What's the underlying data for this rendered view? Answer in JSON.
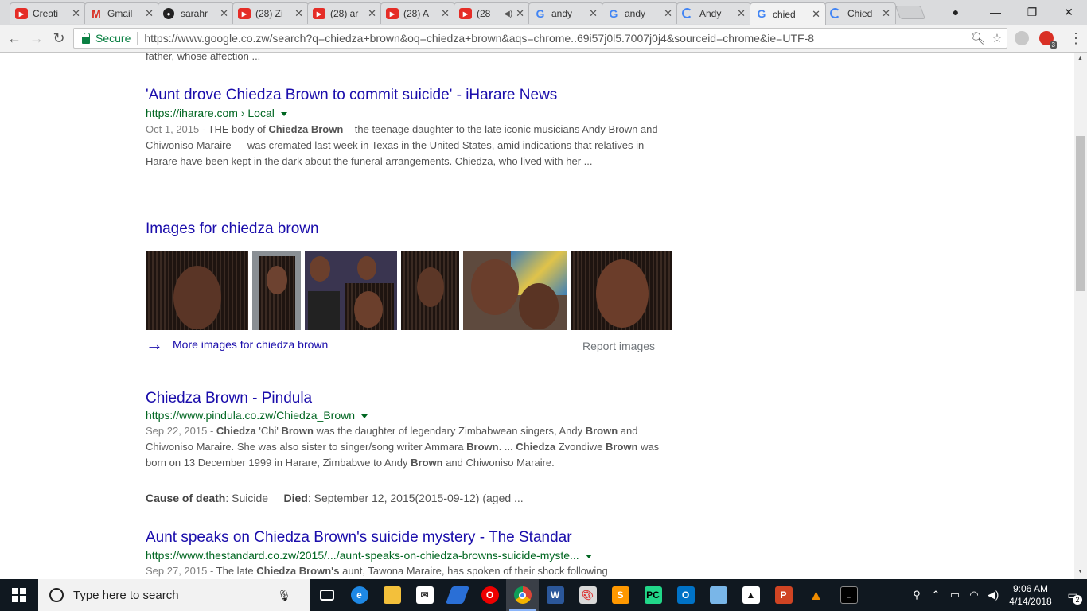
{
  "tabs": [
    {
      "title": "Creati",
      "favicon": "youtube-icon"
    },
    {
      "title": "Gmail",
      "favicon": "gmail-icon"
    },
    {
      "title": "sarahr",
      "favicon": "github-icon"
    },
    {
      "title": "(28) Zi",
      "favicon": "youtube-icon"
    },
    {
      "title": "(28) ar",
      "favicon": "youtube-icon"
    },
    {
      "title": "(28) A",
      "favicon": "youtube-icon"
    },
    {
      "title": "(28",
      "favicon": "youtube-icon",
      "audio": true
    },
    {
      "title": "andy",
      "favicon": "google-icon"
    },
    {
      "title": "andy",
      "favicon": "google-icon"
    },
    {
      "title": "Andy",
      "favicon": "loading-icon"
    },
    {
      "title": "chied",
      "favicon": "google-icon",
      "active": true
    },
    {
      "title": "Chied",
      "favicon": "loading-icon"
    }
  ],
  "toolbar": {
    "secure_label": "Secure",
    "url": "https://www.google.co.zw/search?q=chiedza+brown&oq=chiedza+brown&aqs=chrome..69i57j0l5.7007j0j4&sourceid=chrome&ie=UTF-8",
    "extension_badge": "3"
  },
  "results": {
    "prev_snippet_tail": "father, whose affection ...",
    "r1": {
      "title": "'Aunt drove Chiedza Brown to commit suicide' - iHarare News",
      "url": "https://iharare.com › Local",
      "date": "Oct 1, 2015 - ",
      "snippet_html": "THE body of <b>Chiedza Brown</b> – the teenage daughter to the late iconic musicians Andy Brown and Chiwoniso Maraire — was cremated last week in Texas in the United States, amid indications that relatives in Harare have been kept in the dark about the funeral arrangements. Chiedza, who lived with her ..."
    },
    "images": {
      "heading": "Images for chiedza brown",
      "more_label": "More images for chiedza brown",
      "report_label": "Report images"
    },
    "r2": {
      "title": "Chiedza Brown - Pindula",
      "url": "https://www.pindula.co.zw/Chiedza_Brown",
      "date": "Sep 22, 2015 - ",
      "snippet_html": "<b>Chiedza</b> 'Chi' <b>Brown</b> was the daughter of legendary Zimbabwean singers, Andy <b>Brown</b> and Chiwoniso Maraire. She was also sister to singer/song writer Ammara <b>Brown</b>. ... <b>Chiedza</b> Zvondiwe <b>Brown</b> was born on 13 December 1999 in Harare, Zimbabwe to Andy <b>Brown</b> and Chiwoniso Maraire.",
      "cause_label": "Cause of death",
      "cause_value": ": Suicide",
      "died_label": "Died",
      "died_value": ": September 12, 2015(2015-09-12) (aged ..."
    },
    "r3": {
      "title": "Aunt speaks on Chiedza Brown's suicide mystery - The Standar",
      "url": "https://www.thestandard.co.zw/2015/.../aunt-speaks-on-chiedza-browns-suicide-myste...",
      "date": "Sep 27, 2015 - ",
      "snippet_html": "The late <b>Chiedza Brown's</b> aunt, Tawona Maraire, has spoken of their shock following"
    }
  },
  "taskbar": {
    "search_placeholder": "Type here to search",
    "time": "9:06 AM",
    "date": "4/14/2018",
    "notifications": "2",
    "apps": [
      "task-view-icon",
      "edge-icon",
      "file-explorer-icon",
      "mail-icon",
      "app-icon",
      "opera-icon",
      "chrome-icon",
      "word-icon",
      "paint-icon",
      "sublime-icon",
      "pycharm-icon",
      "outlook-icon",
      "notepad-icon",
      "photos-icon",
      "powerpoint-icon",
      "vlc-icon",
      "terminal-icon"
    ]
  }
}
